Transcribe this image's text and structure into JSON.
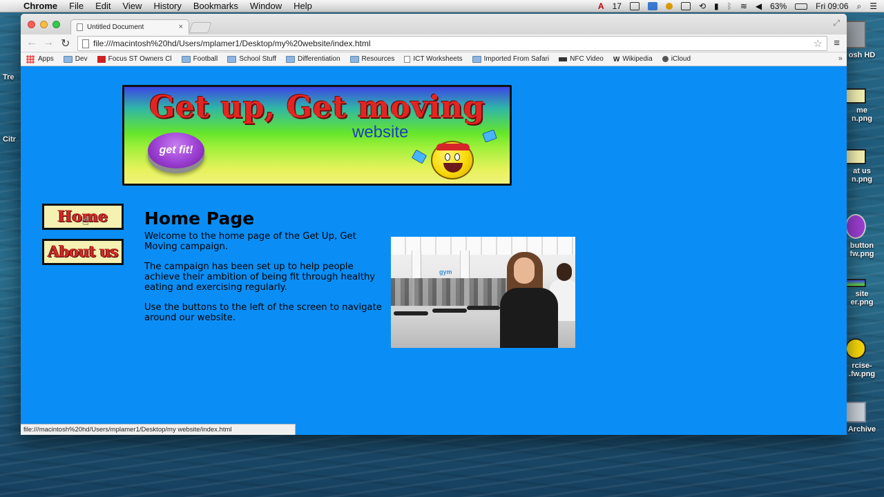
{
  "menubar": {
    "app": "Chrome",
    "items": [
      "File",
      "Edit",
      "View",
      "History",
      "Bookmarks",
      "Window",
      "Help"
    ],
    "status": {
      "notification_count": "17",
      "battery": "63%",
      "clock": "Fri 09:06"
    }
  },
  "desktop": {
    "left_labels": [
      "Tre",
      "Citr"
    ],
    "right_icons": [
      {
        "label": "osh HD",
        "icon": "hard-drive-icon"
      },
      {
        "label": "me\nn.png",
        "icon": "image-file-icon"
      },
      {
        "label": "at us\nn.png",
        "icon": "image-file-icon"
      },
      {
        "label": "button\nfw.png",
        "icon": "image-file-icon"
      },
      {
        "label": "site\ner.png",
        "icon": "image-file-icon"
      },
      {
        "label": "rcise-\n.fw.png",
        "icon": "image-file-icon"
      },
      {
        "label": "Archive",
        "icon": "archive-icon"
      }
    ]
  },
  "browser": {
    "tab_title": "Untitled Document",
    "url": "file:///macintosh%20hd/Users/mplamer1/Desktop/my%20website/index.html",
    "bookmarks": [
      {
        "label": "Apps",
        "icon": "apps-grid-icon"
      },
      {
        "label": "Dev",
        "icon": "folder-icon"
      },
      {
        "label": "Focus ST Owners Cl",
        "icon": "site-favicon-icon"
      },
      {
        "label": "Football",
        "icon": "folder-icon"
      },
      {
        "label": "School Stuff",
        "icon": "folder-icon"
      },
      {
        "label": "Differentiation",
        "icon": "folder-icon"
      },
      {
        "label": "Resources",
        "icon": "folder-icon"
      },
      {
        "label": "ICT Worksheets",
        "icon": "page-icon"
      },
      {
        "label": "Imported From Safari",
        "icon": "folder-icon"
      },
      {
        "label": "NFC Video",
        "icon": "nfc-icon"
      },
      {
        "label": "Wikipedia",
        "icon": "wikipedia-icon"
      },
      {
        "label": "iCloud",
        "icon": "apple-icon"
      }
    ],
    "status_url": "file:///macintosh%20hd/Users/mplamer1/Desktop/my website/index.html"
  },
  "page": {
    "banner": {
      "title": "Get up, Get moving",
      "subtitle": "website",
      "button_text": "get fit!"
    },
    "nav": {
      "home": "Home",
      "about": "About us"
    },
    "heading": "Home Page",
    "paragraphs": [
      "Welcome to the home page of the Get Up, Get Moving campaign.",
      "The campaign has been set up to help people achieve their ambition of being fit through healthy eating and exercising regularly.",
      "Use the buttons to the left of the screen to navigate around our website."
    ],
    "photo_logo": "gym"
  },
  "colors": {
    "page_background": "#0a8ef5",
    "banner_title": "#e32522",
    "nav_button_bg": "#f4f1b2"
  }
}
